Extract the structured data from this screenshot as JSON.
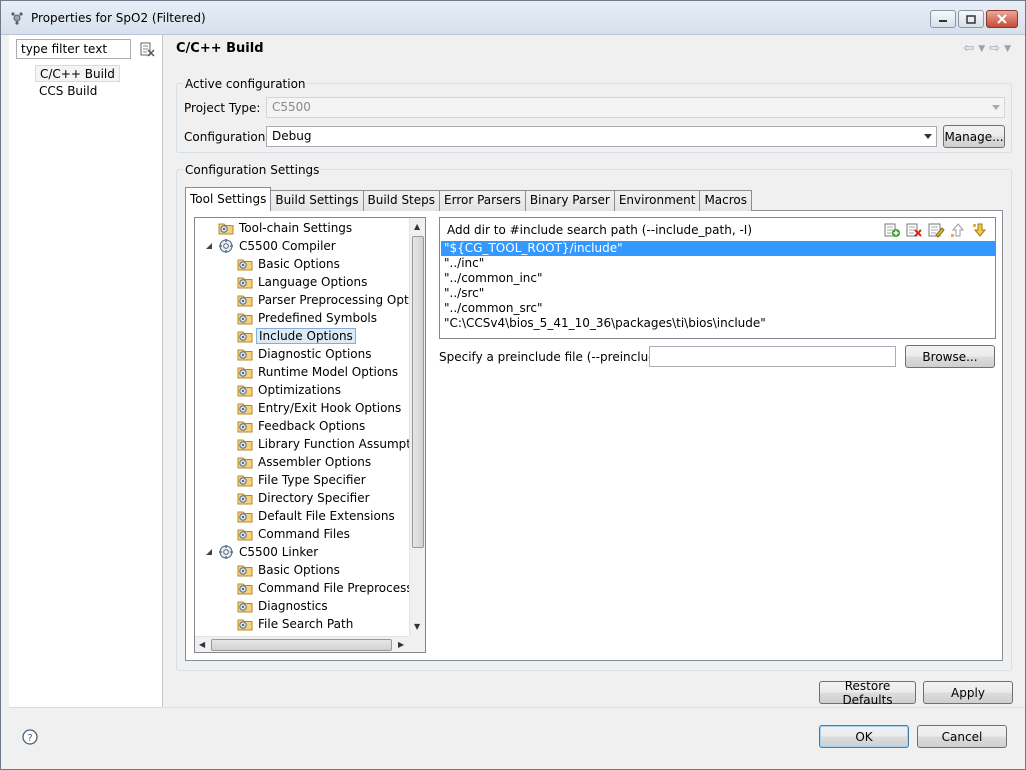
{
  "window": {
    "title": "Properties for SpO2 (Filtered)"
  },
  "nav": {
    "filter_placeholder": "type filter text",
    "items": [
      {
        "label": "C/C++ Build",
        "selected": true
      },
      {
        "label": "CCS Build",
        "selected": false
      }
    ]
  },
  "page": {
    "title": "C/C++ Build"
  },
  "active_config": {
    "group_label": "Active configuration",
    "project_type_label": "Project Type:",
    "project_type_value": "C5500",
    "configuration_label": "Configuration:",
    "configuration_value": "Debug",
    "manage_button": "Manage..."
  },
  "config_settings": {
    "group_label": "Configuration Settings",
    "tabs": [
      {
        "label": "Tool Settings",
        "active": true
      },
      {
        "label": "Build Settings",
        "active": false
      },
      {
        "label": "Build Steps",
        "active": false
      },
      {
        "label": "Error Parsers",
        "active": false
      },
      {
        "label": "Binary Parser",
        "active": false
      },
      {
        "label": "Environment",
        "active": false
      },
      {
        "label": "Macros",
        "active": false
      }
    ]
  },
  "tree": {
    "items": [
      {
        "label": "Tool-chain Settings",
        "level": 0,
        "kind": "folder-gear"
      },
      {
        "label": "C5500 Compiler",
        "level": 0,
        "kind": "tool",
        "expanded": true
      },
      {
        "label": "Basic Options",
        "level": 1,
        "kind": "folder-gear"
      },
      {
        "label": "Language Options",
        "level": 1,
        "kind": "folder-gear"
      },
      {
        "label": "Parser Preprocessing Option",
        "level": 1,
        "kind": "folder-gear"
      },
      {
        "label": "Predefined Symbols",
        "level": 1,
        "kind": "folder-gear"
      },
      {
        "label": "Include Options",
        "level": 1,
        "kind": "folder-gear",
        "selected": true
      },
      {
        "label": "Diagnostic Options",
        "level": 1,
        "kind": "folder-gear"
      },
      {
        "label": "Runtime Model Options",
        "level": 1,
        "kind": "folder-gear"
      },
      {
        "label": "Optimizations",
        "level": 1,
        "kind": "folder-gear"
      },
      {
        "label": "Entry/Exit Hook Options",
        "level": 1,
        "kind": "folder-gear"
      },
      {
        "label": "Feedback Options",
        "level": 1,
        "kind": "folder-gear"
      },
      {
        "label": "Library Function Assumption",
        "level": 1,
        "kind": "folder-gear"
      },
      {
        "label": "Assembler Options",
        "level": 1,
        "kind": "folder-gear"
      },
      {
        "label": "File Type Specifier",
        "level": 1,
        "kind": "folder-gear"
      },
      {
        "label": "Directory Specifier",
        "level": 1,
        "kind": "folder-gear"
      },
      {
        "label": "Default File Extensions",
        "level": 1,
        "kind": "folder-gear"
      },
      {
        "label": "Command Files",
        "level": 1,
        "kind": "folder-gear"
      },
      {
        "label": "C5500 Linker",
        "level": 0,
        "kind": "tool",
        "expanded": true
      },
      {
        "label": "Basic Options",
        "level": 1,
        "kind": "folder-gear"
      },
      {
        "label": "Command File Preprocessin",
        "level": 1,
        "kind": "folder-gear"
      },
      {
        "label": "Diagnostics",
        "level": 1,
        "kind": "folder-gear"
      },
      {
        "label": "File Search Path",
        "level": 1,
        "kind": "folder-gear"
      }
    ]
  },
  "include_paths": {
    "heading": "Add dir to #include search path (--include_path, -I)",
    "items": [
      {
        "value": "\"${CG_TOOL_ROOT}/include\"",
        "selected": true
      },
      {
        "value": "\"../inc\"",
        "selected": false
      },
      {
        "value": "\"../common_inc\"",
        "selected": false
      },
      {
        "value": "\"../src\"",
        "selected": false
      },
      {
        "value": "\"../common_src\"",
        "selected": false
      },
      {
        "value": "\"C:\\CCSv4\\bios_5_41_10_36\\packages\\ti\\bios\\include\"",
        "selected": false
      }
    ],
    "tools": [
      "add-icon",
      "delete-icon",
      "edit-icon",
      "move-up-icon",
      "move-down-icon"
    ]
  },
  "preinclude": {
    "label": "Specify a preinclude file (--preinclude)",
    "value": "",
    "browse_button": "Browse..."
  },
  "footer": {
    "restore_defaults": "Restore Defaults",
    "apply": "Apply",
    "ok": "OK",
    "cancel": "Cancel"
  },
  "colors": {
    "selection": "#3399ff",
    "tree_selection": "#dceaf7"
  }
}
